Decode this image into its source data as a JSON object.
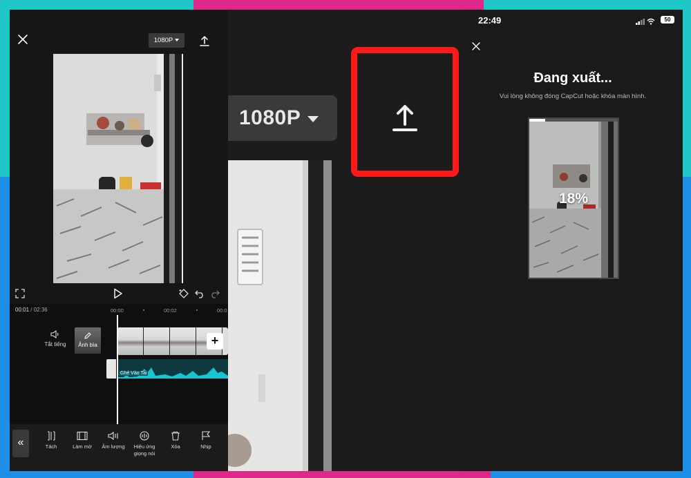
{
  "editor": {
    "resolution": "1080P",
    "current_time": "00:01",
    "total_time": " / 02:36",
    "ruler": [
      "00:00",
      "00:02",
      "00:0"
    ],
    "mute_label": "Tắt tiếng",
    "cover_label": "Ảnh bìa",
    "audio_track_name": "Ghé Vào Tai",
    "tools": [
      {
        "label": "Tách",
        "icon": "split-icon"
      },
      {
        "label": "Làm mờ",
        "icon": "blur-icon"
      },
      {
        "label": "Âm lượng",
        "icon": "volume-icon"
      },
      {
        "label": "Hiệu ứng giọng nói",
        "icon": "voice-effect-icon"
      },
      {
        "label": "Xóa",
        "icon": "delete-icon"
      },
      {
        "label": "Nhịp",
        "icon": "beat-flag-icon"
      }
    ],
    "collapse_glyph": "«",
    "add_glyph": "+"
  },
  "zoom": {
    "resolution": "1080P",
    "highlight_color": "#ff1a1a"
  },
  "exporting": {
    "clock": "22:49",
    "battery": "50",
    "title": "Đang xuất...",
    "subtitle": "Vui lòng không đóng CapCut hoặc khóa màn hình.",
    "progress": 0.18,
    "percent_label": "18%"
  },
  "colors": {
    "frame_cyan": "#1fc7c9",
    "frame_pink": "#e0288a",
    "frame_blue": "#1e8fe6",
    "audio_wave": "#19c3cf"
  }
}
